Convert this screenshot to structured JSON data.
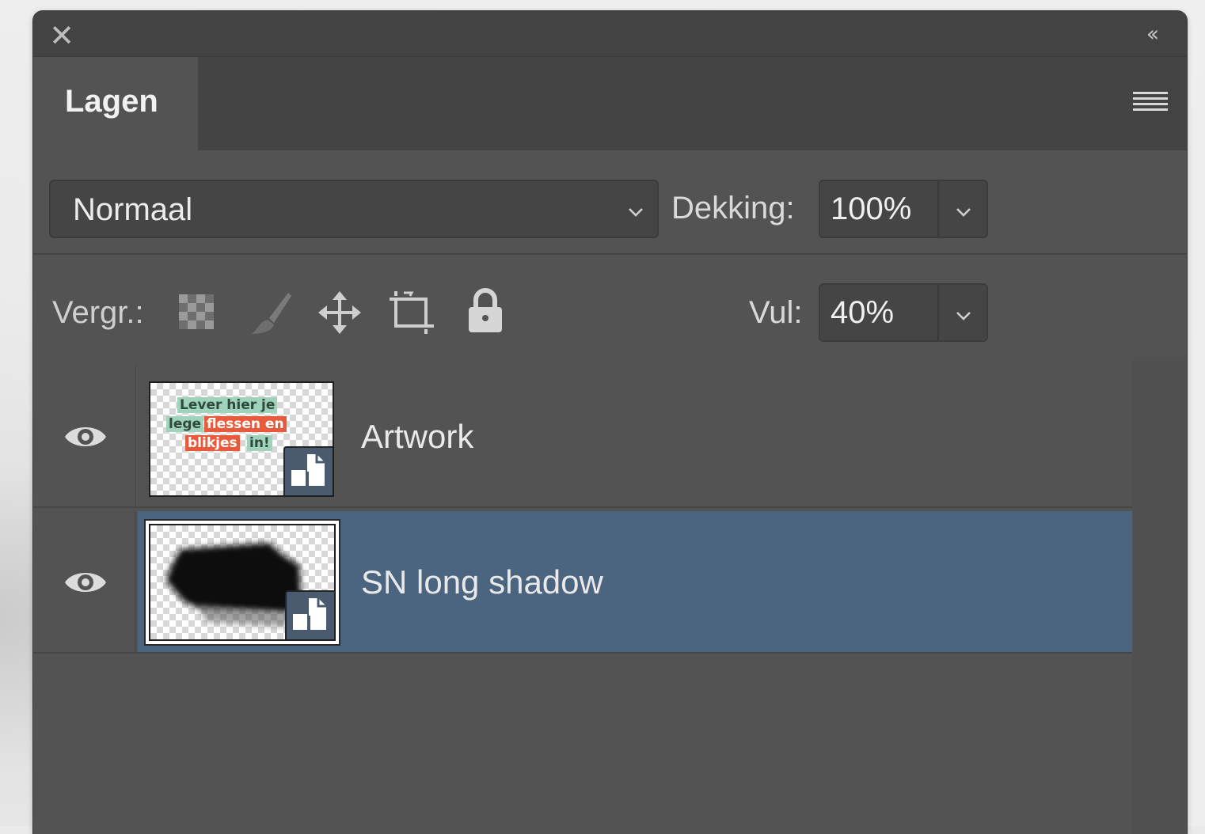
{
  "panel": {
    "close_icon": "close-icon",
    "collapse_icon": "double-chevron-left-icon",
    "menu_icon": "panel-menu-icon"
  },
  "tabs": [
    {
      "label": "Lagen",
      "active": true
    }
  ],
  "blend_mode": {
    "value": "Normaal"
  },
  "opacity": {
    "label": "Dekking:",
    "value": "100%"
  },
  "fill": {
    "label": "Vul:",
    "value": "40%"
  },
  "lock": {
    "label": "Vergr.:",
    "icons": [
      "lock-transparent-pixels-icon",
      "lock-image-pixels-icon",
      "lock-position-icon",
      "lock-artboard-icon",
      "lock-all-icon"
    ]
  },
  "layers": [
    {
      "name": "Artwork",
      "visible": true,
      "selected": false,
      "type": "smart-object",
      "thumbnail_text": [
        "Lever hier je",
        "lege",
        "flessen en",
        "blikjes",
        "in!"
      ]
    },
    {
      "name": "SN long shadow",
      "visible": true,
      "selected": true,
      "type": "smart-object"
    }
  ],
  "colors": {
    "panel_bg": "#535353",
    "titlebar_bg": "#434343",
    "selected_row": "#4b6480",
    "thumb_green": "#9fd3bb",
    "thumb_red": "#e85a3c"
  }
}
